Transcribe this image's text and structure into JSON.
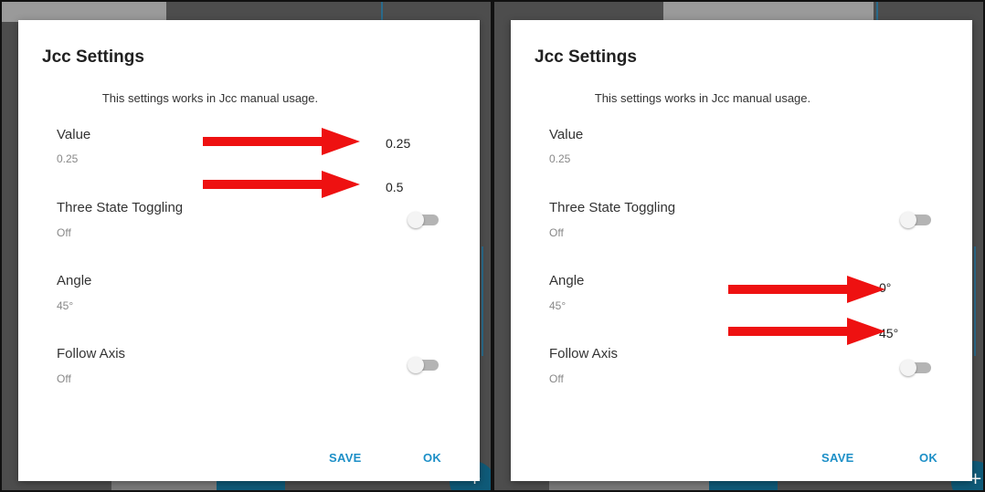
{
  "panels": [
    {
      "dialog": {
        "title": "Jcc Settings",
        "subtitle": "This settings works in Jcc manual usage.",
        "settings": [
          {
            "label": "Value",
            "value": "0.25"
          },
          {
            "label": "Three State Toggling",
            "value": "Off",
            "toggle_on": false
          },
          {
            "label": "Angle",
            "value": "45°"
          },
          {
            "label": "Follow Axis",
            "value": "Off",
            "toggle_on": false
          }
        ],
        "actions": {
          "save": "SAVE",
          "ok": "OK"
        }
      },
      "callouts": [
        "0.25",
        "0.5"
      ]
    },
    {
      "dialog": {
        "title": "Jcc Settings",
        "subtitle": "This settings works in Jcc manual usage.",
        "settings": [
          {
            "label": "Value",
            "value": "0.25"
          },
          {
            "label": "Three State Toggling",
            "value": "Off",
            "toggle_on": false
          },
          {
            "label": "Angle",
            "value": "45°"
          },
          {
            "label": "Follow Axis",
            "value": "Off",
            "toggle_on": false
          }
        ],
        "actions": {
          "save": "SAVE",
          "ok": "OK"
        }
      },
      "callouts": [
        "0°",
        "45°"
      ]
    }
  ],
  "colors": {
    "accent": "#1c8fc7",
    "arrow": "#ee1111",
    "backdrop": "#4d4d4d"
  },
  "icons": {
    "fab": "plus-icon"
  },
  "fab_symbol": "+"
}
